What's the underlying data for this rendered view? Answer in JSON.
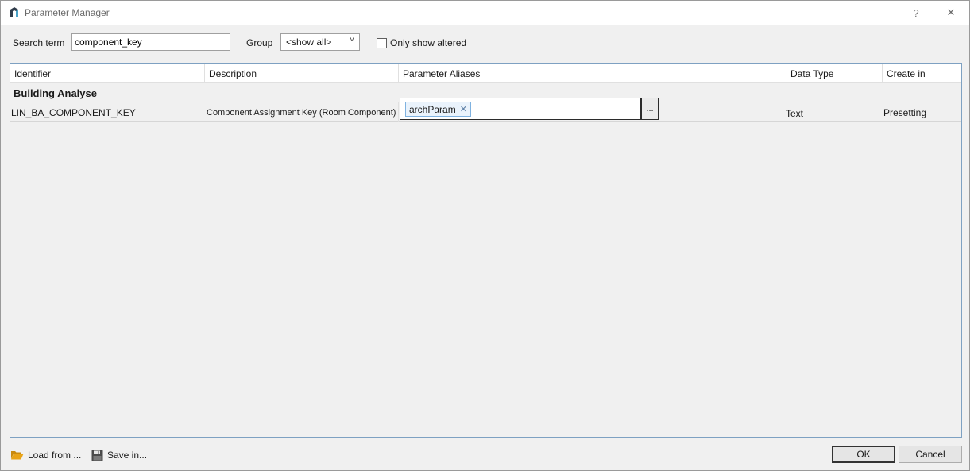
{
  "window": {
    "title": "Parameter Manager",
    "help_glyph": "?",
    "close_glyph": "✕"
  },
  "toolbar": {
    "search_label": "Search term",
    "search_value": "component_key",
    "group_label": "Group",
    "group_selected": "<show all>",
    "only_altered_label": "Only show altered",
    "only_altered_checked": false
  },
  "grid": {
    "columns": [
      "Identifier",
      "Description",
      "Parameter Aliases",
      "Data Type",
      "Create in"
    ],
    "group_name": "Building Analyse",
    "rows": [
      {
        "identifier": "LIN_BA_COMPONENT_KEY",
        "description": "Component Assignment Key (Room Component)",
        "aliases": [
          "archParam"
        ],
        "alias_button": "...",
        "data_type": "Text",
        "create_in": "Presetting"
      }
    ]
  },
  "footer": {
    "load_label": "Load from ...",
    "save_label": "Save in...",
    "ok_label": "OK",
    "cancel_label": "Cancel"
  },
  "icons": {
    "app": "app-logo-icon",
    "load": "folder-open-icon",
    "save": "floppy-disk-icon"
  },
  "colors": {
    "accent_border": "#7ea1c2",
    "chip_border": "#7fb2e0",
    "chip_bg": "#eaf3fc",
    "folder": "#e8a317"
  }
}
